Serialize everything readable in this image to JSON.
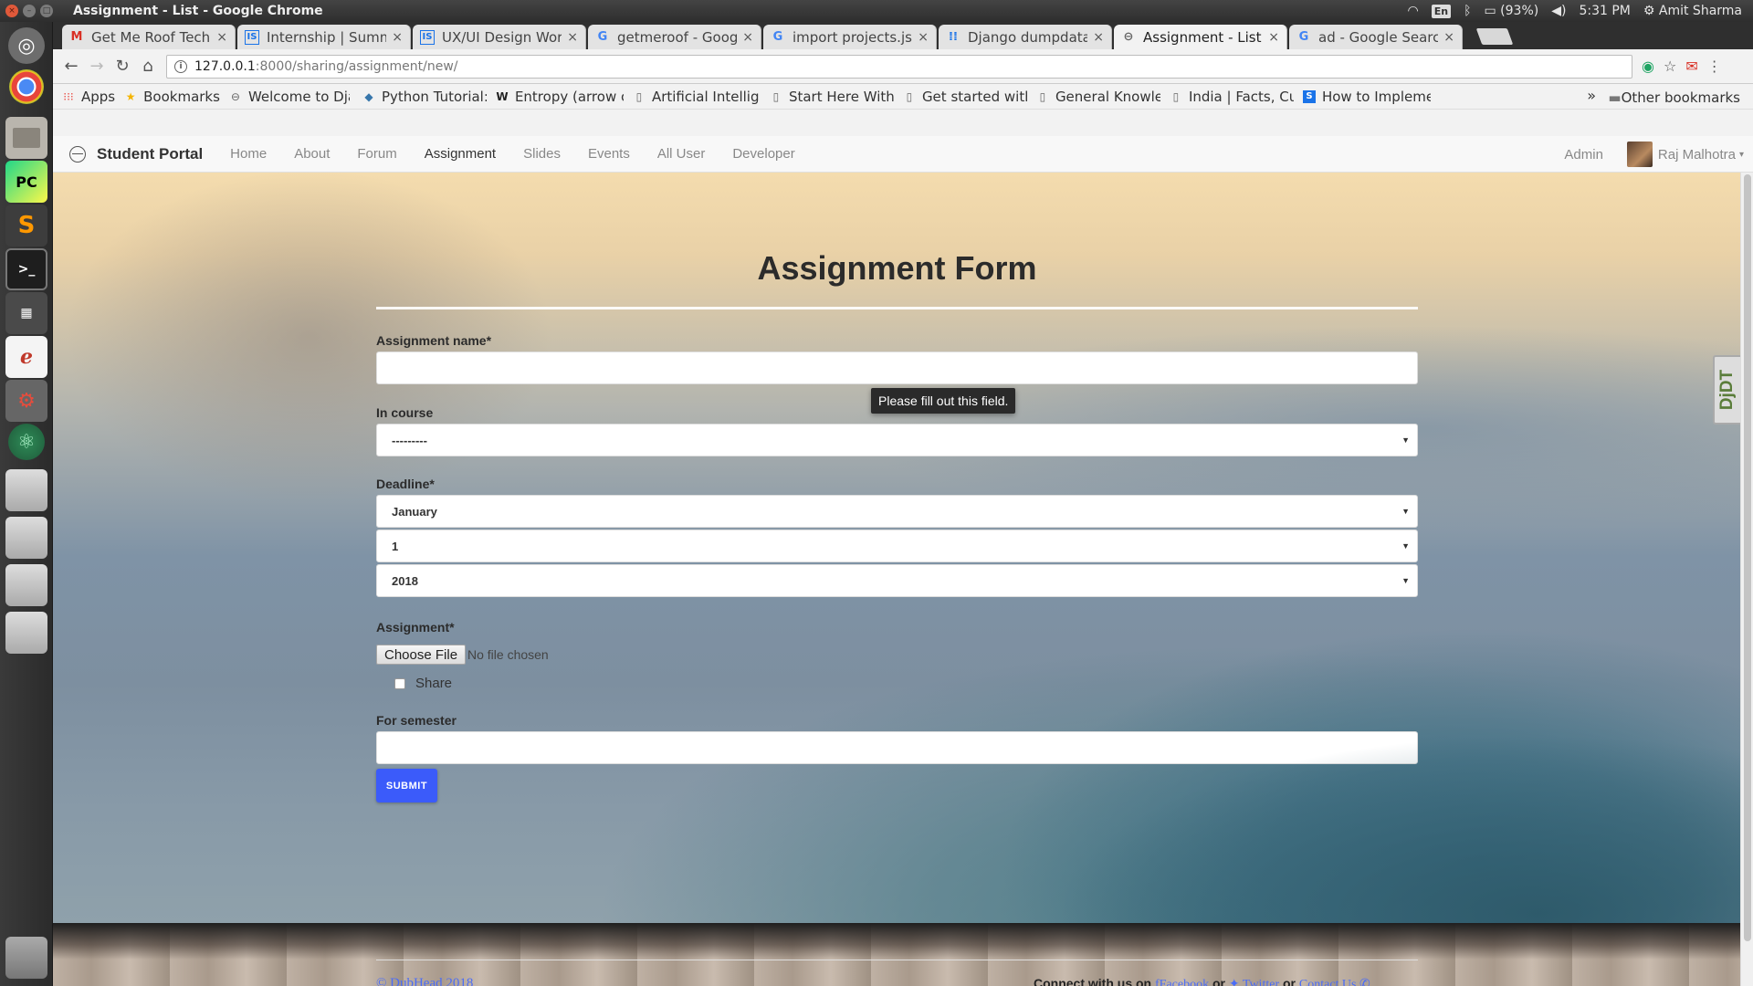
{
  "topbar": {
    "window_title": "Assignment - List - Google Chrome",
    "keyboard_layout": "En",
    "battery": "(93%)",
    "clock": "5:31 PM",
    "user": "Amit Sharma"
  },
  "launcher": {
    "apps": [
      "ubuntu-dash",
      "chrome",
      "files",
      "pycharm",
      "sublime-text",
      "terminal",
      "workspace-switcher",
      "evince",
      "system-settings",
      "atom",
      "drive-1",
      "drive-2",
      "drive-3",
      "drive-4",
      "trash"
    ]
  },
  "tabs": [
    {
      "label": "Get Me Roof Tech A",
      "icon": "gmail-icon",
      "active": false
    },
    {
      "label": "Internship | Summe",
      "icon": "internshala-icon",
      "active": false
    },
    {
      "label": "UX/UI Design Work",
      "icon": "internshala-icon",
      "active": false
    },
    {
      "label": "getmeroof - Google",
      "icon": "google-icon",
      "active": false
    },
    {
      "label": "import projects.jso",
      "icon": "google-icon",
      "active": false
    },
    {
      "label": "Django dumpdata",
      "icon": "dots-icon",
      "active": false
    },
    {
      "label": "Assignment - List",
      "icon": "portal-icon",
      "active": true
    },
    {
      "label": "ad - Google Search",
      "icon": "google-icon",
      "active": false
    }
  ],
  "address": {
    "host": "127.0.0.1",
    "path": ":8000/sharing/assignment/new/"
  },
  "bookmarks": {
    "items": [
      {
        "label": "Apps",
        "icon": "apps-grid-icon"
      },
      {
        "label": "Bookmarks",
        "icon": "star-icon"
      },
      {
        "label": "Welcome to Dja",
        "icon": "portal-icon"
      },
      {
        "label": "Python Tutorial:",
        "icon": "python-icon"
      },
      {
        "label": "Entropy (arrow c",
        "icon": "wikipedia-icon"
      },
      {
        "label": "Artificial Intellig",
        "icon": "page-icon"
      },
      {
        "label": "Start Here With",
        "icon": "page-icon"
      },
      {
        "label": "Get started with",
        "icon": "page-icon"
      },
      {
        "label": "General Knowle",
        "icon": "page-icon"
      },
      {
        "label": "India | Facts, Cul",
        "icon": "page-icon"
      },
      {
        "label": "How to Impleme",
        "icon": "stackoverflow-icon"
      }
    ],
    "more": "»",
    "other": "Other bookmarks"
  },
  "navbar": {
    "brand": "Student Portal",
    "links": [
      "Home",
      "About",
      "Forum",
      "Assignment",
      "Slides",
      "Events",
      "All User",
      "Developer"
    ],
    "active_link": "Assignment",
    "admin": "Admin",
    "user": "Raj Malhotra"
  },
  "form": {
    "title": "Assignment Form",
    "name_label": "Assignment name*",
    "name_value": "",
    "validation_tooltip": "Please fill out this field.",
    "course_label": "In course",
    "course_value": "---------",
    "deadline_label": "Deadline*",
    "deadline_month": "January",
    "deadline_day": "1",
    "deadline_year": "2018",
    "file_label": "Assignment*",
    "file_button": "Choose File",
    "file_status": "No file chosen",
    "share_label": "Share",
    "share_checked": false,
    "semester_label": "For semester",
    "semester_value": "",
    "submit": "SUBMIT"
  },
  "debug_toolbar": {
    "label": "DjDT"
  },
  "footer": {
    "copyright": "© DubHead 2018",
    "connect_prefix": "Connect with us on",
    "facebook": "Facebook",
    "or1": "or",
    "twitter": "Twitter",
    "or2": "or",
    "contact": "Contact Us"
  }
}
